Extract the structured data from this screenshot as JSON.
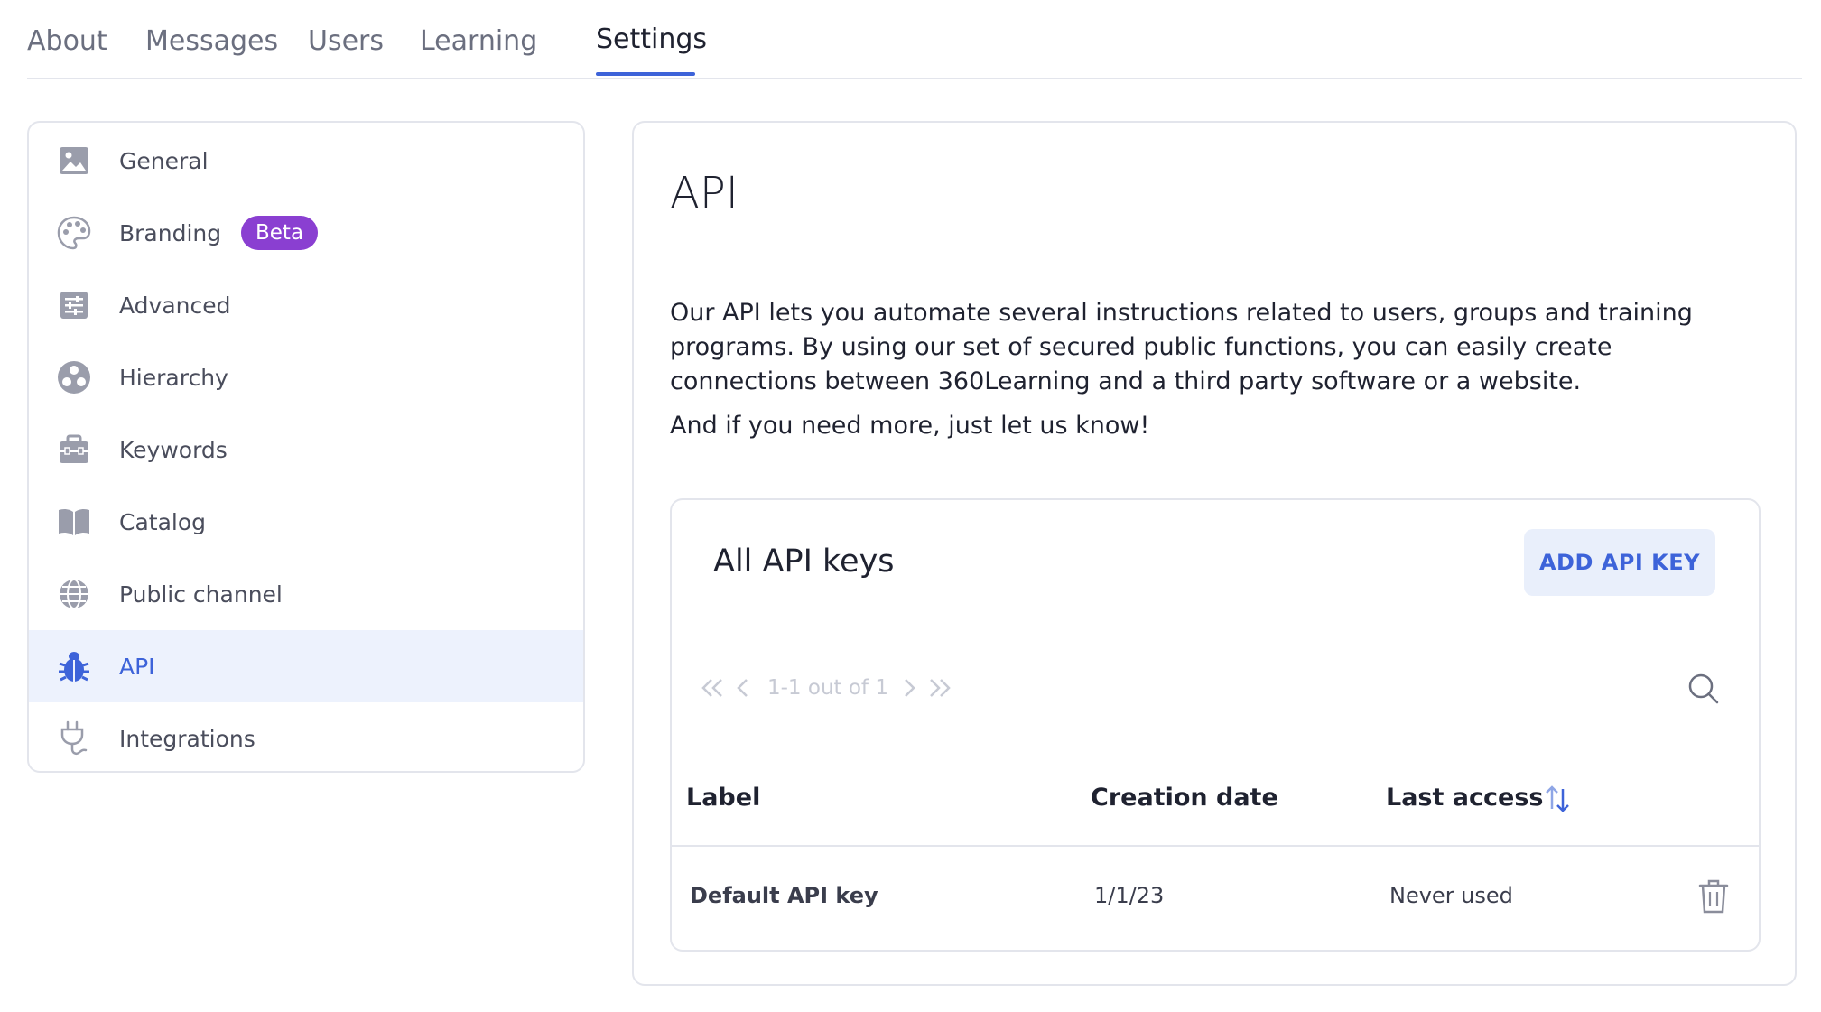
{
  "tabs": [
    {
      "label": "About"
    },
    {
      "label": "Messages"
    },
    {
      "label": "Users"
    },
    {
      "label": "Learning"
    },
    {
      "label": "Settings",
      "active": true
    }
  ],
  "sidebar": {
    "items": [
      {
        "label": "General",
        "icon": "image-icon"
      },
      {
        "label": "Branding",
        "icon": "palette-icon",
        "badge": "Beta"
      },
      {
        "label": "Advanced",
        "icon": "sliders-icon"
      },
      {
        "label": "Hierarchy",
        "icon": "hierarchy-icon"
      },
      {
        "label": "Keywords",
        "icon": "briefcase-icon"
      },
      {
        "label": "Catalog",
        "icon": "book-icon"
      },
      {
        "label": "Public channel",
        "icon": "globe-icon"
      },
      {
        "label": "API",
        "icon": "bug-icon",
        "active": true
      },
      {
        "label": "Integrations",
        "icon": "plug-icon"
      }
    ]
  },
  "main": {
    "title": "API",
    "description": "Our API lets you automate several instructions related to users, groups and training programs. By using our set of secured public functions, you can easily create connections between 360Learning and a third party software or a website.",
    "description2": "And if you need more, just let us know!"
  },
  "keys": {
    "title": "All API keys",
    "add_button": "ADD API KEY",
    "pagination": "1-1 out of 1",
    "columns": [
      "Label",
      "Creation date",
      "Last access"
    ],
    "rows": [
      {
        "label": "Default API key",
        "created": "1/1/23",
        "last_access": "Never used"
      }
    ]
  },
  "colors": {
    "accent": "#3d63d9",
    "beta_badge": "#8a3fd1",
    "active_bg": "#edf2fd",
    "border": "#e3e5ec"
  }
}
